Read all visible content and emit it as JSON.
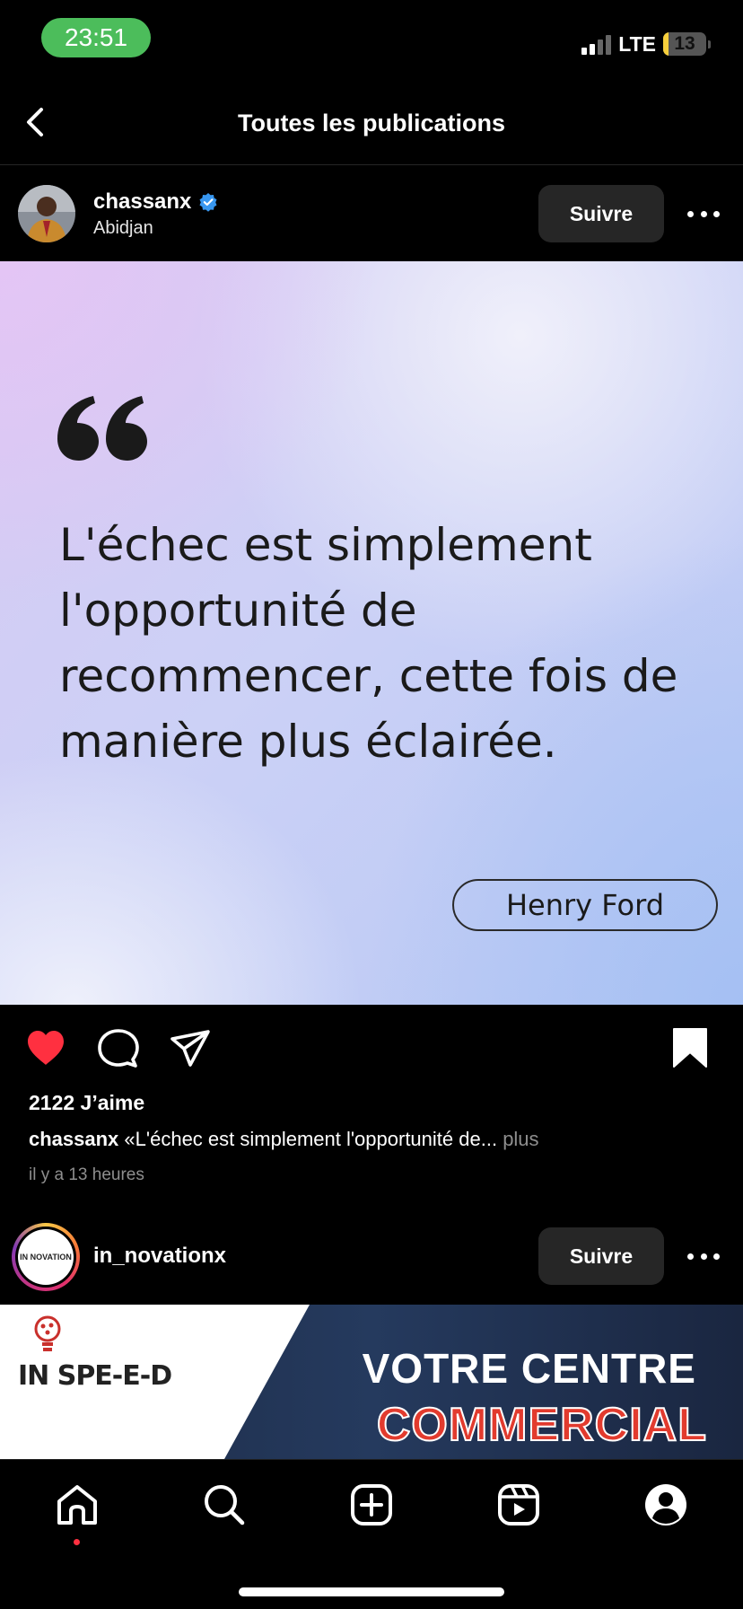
{
  "status_bar": {
    "time": "23:51",
    "network": "LTE",
    "battery": "13",
    "battery_level_percent": 13
  },
  "header": {
    "title": "Toutes les publications"
  },
  "post1": {
    "username": "chassanx",
    "verified": true,
    "location": "Abidjan",
    "follow_label": "Suivre",
    "quote_text": "L'échec est simplement l'opportunité de recommencer, cette fois de manière plus éclairée.",
    "quote_author": "Henry Ford",
    "liked": true,
    "likes": "2122 J’aime",
    "caption_user": "chassanx",
    "caption_text": "«L'échec est simplement l'opportunité de...",
    "caption_more": "plus",
    "time_ago": "il y a 13 heures"
  },
  "post2": {
    "username": "in_novationx",
    "avatar_text": "IN NOVATION",
    "follow_label": "Suivre",
    "banner_logo": "IN SPE-E-D",
    "banner_line1": "VOTRE CENTRE",
    "banner_line2": "COMMERCIAL"
  },
  "tab_bar": {
    "items": [
      "home",
      "search",
      "create",
      "reels",
      "profile"
    ],
    "active": "home"
  },
  "colors": {
    "like_red": "#ff3040",
    "verified_blue": "#3897f0",
    "time_pill_green": "#4cbd5b"
  }
}
